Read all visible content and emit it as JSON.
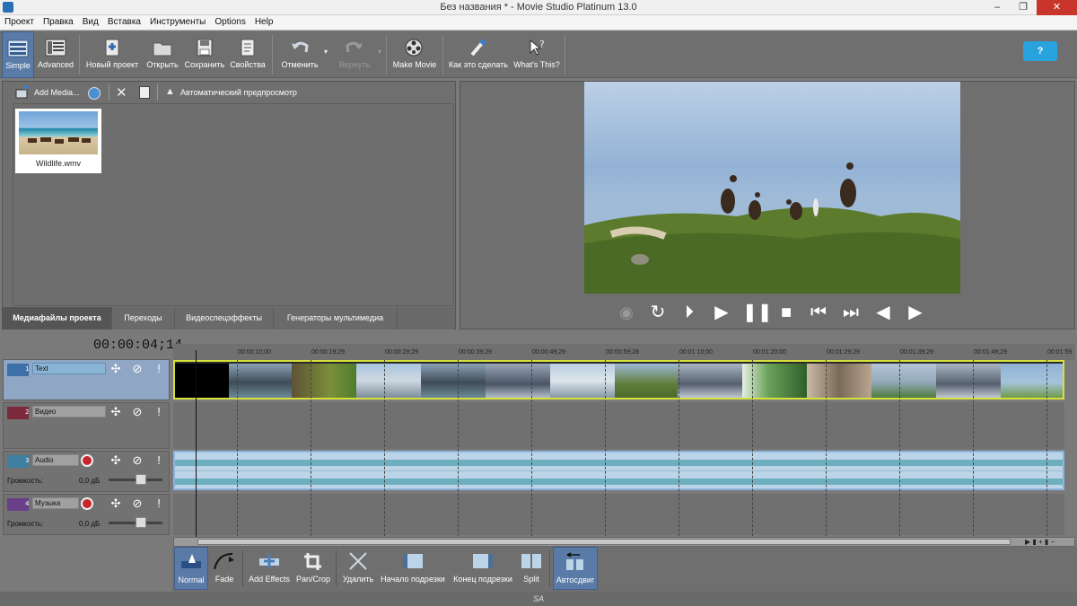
{
  "title": "Без названия * - Movie Studio Platinum 13.0",
  "menu": [
    "Проект",
    "Правка",
    "Вид",
    "Вставка",
    "Инструменты",
    "Options",
    "Help"
  ],
  "toolbar": {
    "simple": "Simple",
    "advanced": "Advanced",
    "new_project": "Новый проект",
    "open": "Открыть",
    "save": "Сохранить",
    "properties": "Свойства",
    "undo": "Отменить",
    "redo": "Вернуть",
    "make_movie": "Make Movie",
    "how_to": "Как это сделать",
    "whats_this": "What's This?",
    "help": "?"
  },
  "media": {
    "add_media": "Add Media...",
    "auto_preview": "Автоматический предпросмотр",
    "file": "Wildlife.wmv",
    "tabs": [
      "Медиафайлы проекта",
      "Переходы",
      "Видеоспецэффекты",
      "Генераторы мультимедиа"
    ]
  },
  "timeline": {
    "timecode": "00:00:04;14",
    "ticks": [
      "00:00:10;00",
      "00:00:19;29",
      "00:00:29;29",
      "00:00:39;29",
      "00:00:49;29",
      "00:00:59;28",
      "00:01:10;00",
      "00:01:20;00",
      "00:01:29;29",
      "00:01:39;29",
      "00:01:49;29",
      "00:01:59"
    ],
    "tracks": [
      {
        "num": "1",
        "name": "Text"
      },
      {
        "num": "2",
        "name": "Видео"
      },
      {
        "num": "3",
        "name": "Audio",
        "volume_label": "Громкость:",
        "volume": "0,0 дБ"
      },
      {
        "num": "4",
        "name": "Музыка",
        "volume_label": "Громкость:",
        "volume": "0,0 дБ"
      }
    ]
  },
  "bottom": {
    "normal": "Normal",
    "fade": "Fade",
    "add_effects": "Add Effects",
    "pancrop": "Pan/Crop",
    "delete": "Удалить",
    "trim_start": "Начало подрезки",
    "trim_end": "Конец подрезки",
    "split": "Split",
    "autoripple": "Автосдвиг"
  },
  "status": "SA"
}
